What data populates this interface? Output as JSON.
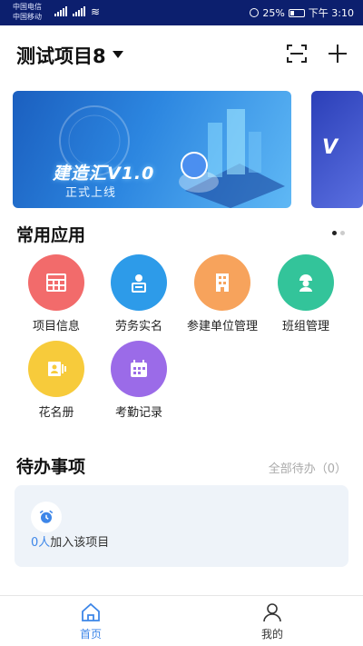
{
  "status_bar": {
    "carrier1": "中国电信",
    "carrier2": "中国移动",
    "battery": "25%",
    "time": "下午 3:10"
  },
  "header": {
    "project_name": "测试项目8",
    "icons": [
      "scan-icon",
      "plus-icon"
    ]
  },
  "banners": [
    {
      "title": "建造汇V1.0",
      "subtitle": "正式上线"
    },
    {
      "title": "V"
    }
  ],
  "common_apps": {
    "title": "常用应用",
    "items": [
      {
        "label": "项目信息",
        "icon": "table-grid-icon",
        "color": "#f26b6b"
      },
      {
        "label": "劳务实名",
        "icon": "id-card-user-icon",
        "color": "#2d9be9"
      },
      {
        "label": "参建单位管理",
        "icon": "building-icon",
        "color": "#f7a35c"
      },
      {
        "label": "班组管理",
        "icon": "worker-team-icon",
        "color": "#33c49a"
      },
      {
        "label": "花名册",
        "icon": "roster-icon",
        "color": "#f7cb3b"
      },
      {
        "label": "考勤记录",
        "icon": "calendar-icon",
        "color": "#9b6be8"
      }
    ]
  },
  "todo": {
    "title": "待办事项",
    "all_label": "全部待办（0）",
    "count": "0人",
    "text": "加入该项目",
    "icon": "alarm-clock-icon",
    "accent": "#3d86e8"
  },
  "bottom_nav": {
    "items": [
      {
        "label": "首页",
        "icon": "home-icon",
        "active": true
      },
      {
        "label": "我的",
        "icon": "user-icon",
        "active": false
      }
    ]
  }
}
